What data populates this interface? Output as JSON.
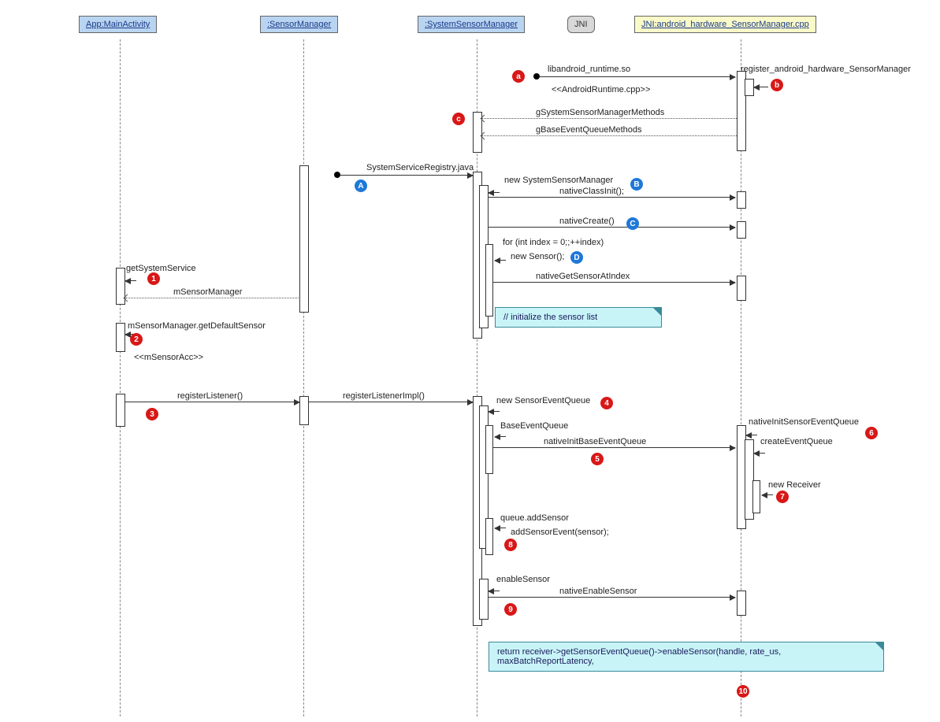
{
  "participants": {
    "p1": "App:MainActivity",
    "p2": ":SensorManager",
    "p3": ":SystemSensorManager",
    "p4": "JNI",
    "p5": "JNI:android_hardware_SensorManager.cpp"
  },
  "messages": {
    "m_lib": "libandroid_runtime.so",
    "m_androidruntime": "<<AndroidRuntime.cpp>>",
    "m_register": "register_android_hardware_SensorManager",
    "m_gsys": "gSystemSensorManagerMethods",
    "m_gbase": "gBaseEventQueueMethods",
    "m_sysreg": "SystemServiceRegistry.java",
    "m_newssm": "new SystemSensorManager",
    "m_nci": "nativeClassInit();",
    "m_nc": "nativeCreate()",
    "m_for": "for (int index = 0;;++index)",
    "m_newsensor": "new Sensor();",
    "m_ngsai": "nativeGetSensorAtIndex",
    "m_getss": "getSystemService",
    "m_msm": "mSensorManager",
    "m_gds": "mSensorManager.getDefaultSensor",
    "m_msensoracc": "<<mSensorAcc>>",
    "m_reglistener": "registerListener()",
    "m_reglistenerimpl": "registerListenerImpl()",
    "m_newseq": "new SensorEventQueue",
    "m_beq": "BaseEventQueue",
    "m_nibeq": "nativeInitBaseEventQueue",
    "m_niseq": "nativeInitSensorEventQueue",
    "m_ceq": "createEventQueue",
    "m_newrecv": "new Receiver",
    "m_qadd": "queue.addSensor",
    "m_ase": "addSensorEvent(sensor);",
    "m_es": "enableSensor",
    "m_nes": "nativeEnableSensor"
  },
  "notes": {
    "n1": "// initialize the sensor list",
    "n2": "return receiver->getSensorEventQueue()->enableSensor(handle, rate_us, maxBatchReportLatency,"
  },
  "badges": {
    "a": "a",
    "b": "b",
    "c": "c",
    "A": "A",
    "B": "B",
    "C": "C",
    "D": "D",
    "1": "1",
    "2": "2",
    "3": "3",
    "4": "4",
    "5": "5",
    "6": "6",
    "7": "7",
    "8": "8",
    "9": "9",
    "10": "10"
  },
  "chart_data": {
    "type": "sequence-diagram",
    "participants": [
      {
        "id": "App:MainActivity",
        "style": "blue"
      },
      {
        "id": ":SensorManager",
        "style": "blue"
      },
      {
        "id": ":SystemSensorManager",
        "style": "blue"
      },
      {
        "id": "JNI",
        "style": "grey"
      },
      {
        "id": "JNI:android_hardware_SensorManager.cpp",
        "style": "yellow"
      }
    ],
    "interactions": [
      {
        "from": "found",
        "to": "JNI:android_hardware_SensorManager.cpp",
        "label": "libandroid_runtime.so",
        "stereotype": "<<AndroidRuntime.cpp>>",
        "badge": "a"
      },
      {
        "from": "JNI:android_hardware_SensorManager.cpp",
        "to": "JNI:android_hardware_SensorManager.cpp",
        "label": "register_android_hardware_SensorManager",
        "badge": "b"
      },
      {
        "from": "JNI:android_hardware_SensorManager.cpp",
        "to": ":SystemSensorManager",
        "label": "gSystemSensorManagerMethods",
        "style": "return",
        "badge": "c"
      },
      {
        "from": "JNI:android_hardware_SensorManager.cpp",
        "to": ":SystemSensorManager",
        "label": "gBaseEventQueueMethods",
        "style": "return"
      },
      {
        "from": "found",
        "to": ":SystemSensorManager",
        "label": "SystemServiceRegistry.java",
        "badge": "A"
      },
      {
        "from": ":SystemSensorManager",
        "to": ":SystemSensorManager",
        "label": "new SystemSensorManager"
      },
      {
        "from": ":SystemSensorManager",
        "to": "JNI:android_hardware_SensorManager.cpp",
        "label": "nativeClassInit();",
        "badge": "B"
      },
      {
        "from": ":SystemSensorManager",
        "to": "JNI:android_hardware_SensorManager.cpp",
        "label": "nativeCreate()",
        "badge": "C"
      },
      {
        "from": ":SystemSensorManager",
        "to": ":SystemSensorManager",
        "label": "for (int index = 0;;++index)"
      },
      {
        "from": ":SystemSensorManager",
        "to": ":SystemSensorManager",
        "label": "new Sensor();",
        "badge": "D"
      },
      {
        "from": ":SystemSensorManager",
        "to": "JNI:android_hardware_SensorManager.cpp",
        "label": "nativeGetSensorAtIndex"
      },
      {
        "note": "// initialize the sensor list",
        "attached_to": ":SystemSensorManager"
      },
      {
        "from": "App:MainActivity",
        "to": "App:MainActivity",
        "label": "getSystemService",
        "badge": "1"
      },
      {
        "from": ":SensorManager",
        "to": "App:MainActivity",
        "label": "mSensorManager",
        "style": "return"
      },
      {
        "from": "App:MainActivity",
        "to": "App:MainActivity",
        "label": "mSensorManager.getDefaultSensor",
        "stereotype": "<<mSensorAcc>>",
        "badge": "2"
      },
      {
        "from": "App:MainActivity",
        "to": ":SensorManager",
        "label": "registerListener()",
        "badge": "3"
      },
      {
        "from": ":SensorManager",
        "to": ":SystemSensorManager",
        "label": "registerListenerImpl()"
      },
      {
        "from": ":SystemSensorManager",
        "to": ":SystemSensorManager",
        "label": "new SensorEventQueue",
        "badge": "4"
      },
      {
        "from": ":SystemSensorManager",
        "to": ":SystemSensorManager",
        "label": "BaseEventQueue"
      },
      {
        "from": ":SystemSensorManager",
        "to": "JNI:android_hardware_SensorManager.cpp",
        "label": "nativeInitBaseEventQueue",
        "badge": "5"
      },
      {
        "from": "JNI:android_hardware_SensorManager.cpp",
        "to": "JNI:android_hardware_SensorManager.cpp",
        "label": "nativeInitSensorEventQueue",
        "badge": "6"
      },
      {
        "from": "JNI:android_hardware_SensorManager.cpp",
        "to": "JNI:android_hardware_SensorManager.cpp",
        "label": "createEventQueue"
      },
      {
        "from": "JNI:android_hardware_SensorManager.cpp",
        "to": "JNI:android_hardware_SensorManager.cpp",
        "label": "new Receiver",
        "badge": "7"
      },
      {
        "from": ":SystemSensorManager",
        "to": ":SystemSensorManager",
        "label": "queue.addSensor"
      },
      {
        "from": ":SystemSensorManager",
        "to": ":SystemSensorManager",
        "label": "addSensorEvent(sensor);",
        "badge": "8"
      },
      {
        "from": ":SystemSensorManager",
        "to": ":SystemSensorManager",
        "label": "enableSensor"
      },
      {
        "from": ":SystemSensorManager",
        "to": "JNI:android_hardware_SensorManager.cpp",
        "label": "nativeEnableSensor",
        "badge": "9"
      },
      {
        "note": "return receiver->getSensorEventQueue()->enableSensor(handle, rate_us, maxBatchReportLatency,",
        "badge": "10"
      }
    ]
  }
}
